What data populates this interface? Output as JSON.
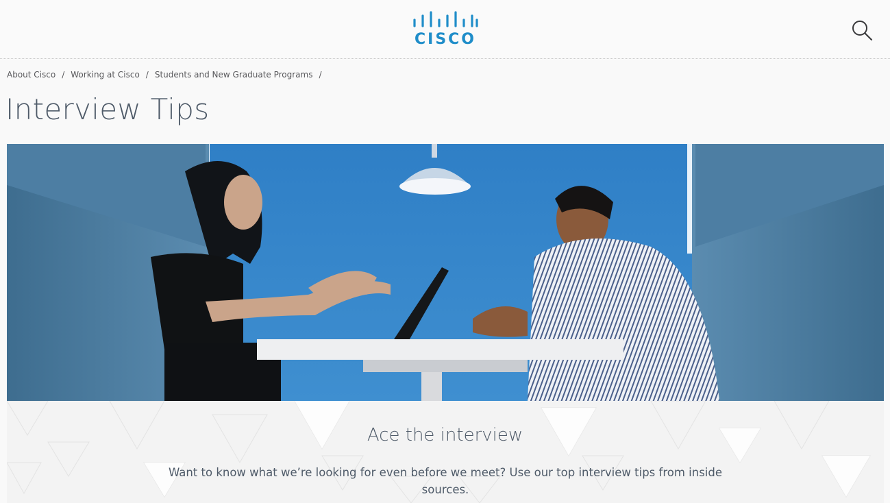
{
  "header": {
    "logo_text": "CISCO",
    "logo_icon": "cisco-bridge-logo",
    "search_icon": "search-icon",
    "brand_color": "#1f8dc9"
  },
  "breadcrumb": {
    "items": [
      "About Cisco",
      "Working at Cisco",
      "Students and New Graduate Programs"
    ],
    "separator": "/"
  },
  "page": {
    "title": "Interview Tips"
  },
  "hero": {
    "description_visual": "photo"
  },
  "section": {
    "heading": "Ace the interview",
    "body": "Want to know what we’re looking for even before we meet? Use our top interview tips from inside sources."
  },
  "colors": {
    "text": "#4f5b69",
    "hero_blue": "#3a7fbe",
    "background": "#f9f9f9"
  }
}
